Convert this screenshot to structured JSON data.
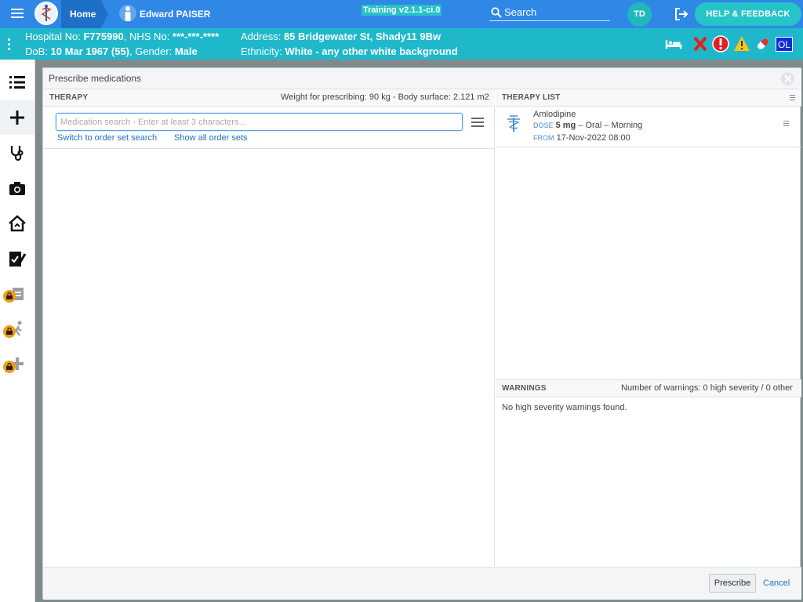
{
  "topbar": {
    "home_label": "Home",
    "patient_name": "Edward PAISER",
    "version_badge": "Training v2.1.1-ci.0",
    "search_label": "Search",
    "user_initials": "TD",
    "help_button": "HELP & FEEDBACK"
  },
  "banner": {
    "hospital_no_label": "Hospital No:",
    "hospital_no": "F775990",
    "nhs_no_label": "NHS No:",
    "nhs_no": "***-***-****",
    "dob_label": "DoB:",
    "dob": "10 Mar 1967 (55)",
    "gender_label": "Gender:",
    "gender": "Male",
    "address_label": "Address:",
    "address": "85 Bridgewater St, Shady11 9Bw",
    "ethnicity_label": "Ethnicity:",
    "ethnicity": "White - any other white background",
    "ol_badge": "OL"
  },
  "modal": {
    "title": "Prescribe medications",
    "therapy_section": "THERAPY",
    "weight_info": "Weight for prescribing: 90 kg - Body surface: 2.121 m2",
    "search_placeholder": "Medication search - Enter at least 3 characters...",
    "switch_link": "Switch to order set search",
    "show_all_link": "Show all order sets",
    "therapy_list_section": "THERAPY LIST",
    "therapy_items": [
      {
        "drug": "Amlodipine",
        "dose_tag": "DOSE",
        "dose": "5 mg",
        "route_time": "– Oral – Morning",
        "from_tag": "FROM",
        "from": "17-Nov-2022 08:00"
      }
    ],
    "warnings_section": "WARNINGS",
    "warnings_count": "Number of warnings: 0 high severity / 0 other",
    "warnings_text": "No high severity warnings found.",
    "prescribe_button": "Prescribe",
    "cancel_button": "Cancel"
  },
  "colors": {
    "topbar": "#2f87e6",
    "banner": "#1fb8cb",
    "accent_teal": "#26c3c9",
    "link": "#1f6fbf"
  },
  "icons": {
    "sidebar": [
      "list-icon",
      "plus-icon",
      "stethoscope-icon",
      "camera-icon",
      "home-icon",
      "edit-document-icon",
      "locked-clipboard-icon",
      "locked-walking-icon",
      "locked-plus-icon"
    ],
    "banner": [
      "bed-icon",
      "red-x-icon",
      "alert-icon",
      "warning-icon",
      "pill-icon"
    ]
  }
}
